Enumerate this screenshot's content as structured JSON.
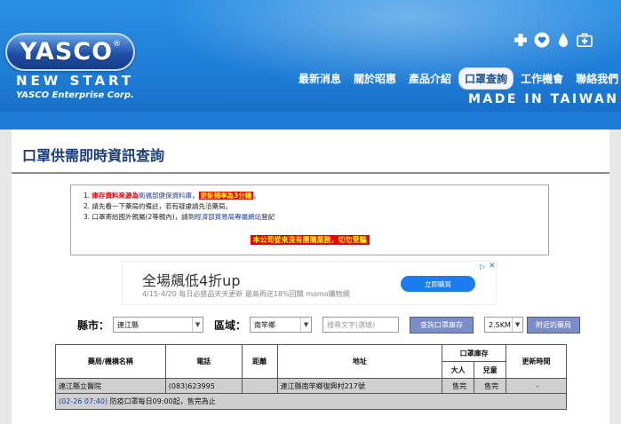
{
  "header": {
    "logo": "YASCO",
    "logo_mark": "®",
    "tagline": "NEW START",
    "company": "YASCO Enterprise Corp.",
    "made_in": "MADE IN TAIWAN",
    "nav": [
      {
        "label": "最新消息"
      },
      {
        "label": "關於昭惠"
      },
      {
        "label": "產品介紹"
      },
      {
        "label": "口罩查詢",
        "active": true
      },
      {
        "label": "工作機會"
      },
      {
        "label": "聯絡我們"
      }
    ],
    "icons": [
      "plus-icon",
      "heart-icon",
      "drop-icon",
      "first-aid-icon"
    ]
  },
  "page": {
    "title": "口罩供需即時資訊查詢"
  },
  "notice": {
    "l1_a": "1. ",
    "l1_red": "庫存資料來源為",
    "l1_blue": "衛福部健保資料庫",
    "l1_sep": "，",
    "l1_hl": "更新頻率為3分鐘",
    "l1_end": "。",
    "l2": "2. 請先看一下藥局的備註，若有疑慮請先洽藥局。",
    "l3_a": "3. 口罩寄給國外親屬(2等親內)，請到",
    "l3_link": "經濟部貿易局專屬網站",
    "l3_b": "登記",
    "warning": "本公司從來沒有團購業務，切勿受騙"
  },
  "ad": {
    "title": "全場飆低4折up",
    "desc": "4/15-4/20 每日必搶品天天更新 最高再送18%回饋 momo購物網",
    "button": "立即購買"
  },
  "search": {
    "county_label": "縣市：",
    "county_value": "連江縣",
    "area_label": "區域：",
    "area_value": "南竿鄉",
    "keyword_placeholder": "搜尋文字(選填)",
    "query_button": "查詢口罩庫存",
    "distance_value": "2.5KM",
    "nearby_button": "附近的藥局"
  },
  "table": {
    "headers": {
      "name": "藥局/機構名稱",
      "phone": "電話",
      "distance": "距離",
      "address": "地址",
      "stock": "口罩庫存",
      "adult": "大人",
      "child": "兒童",
      "updated": "更新時間"
    },
    "rows": [
      {
        "name": "連江縣立醫院",
        "phone": "(083)623995",
        "distance": "",
        "address": "連江縣南竿鄉復興村217號",
        "adult": "售完",
        "child": "售完",
        "updated": "-",
        "note_time": "(02-26 07:40)",
        "note_text": " 防疫口罩每日09:00起，售完為止"
      }
    ]
  }
}
